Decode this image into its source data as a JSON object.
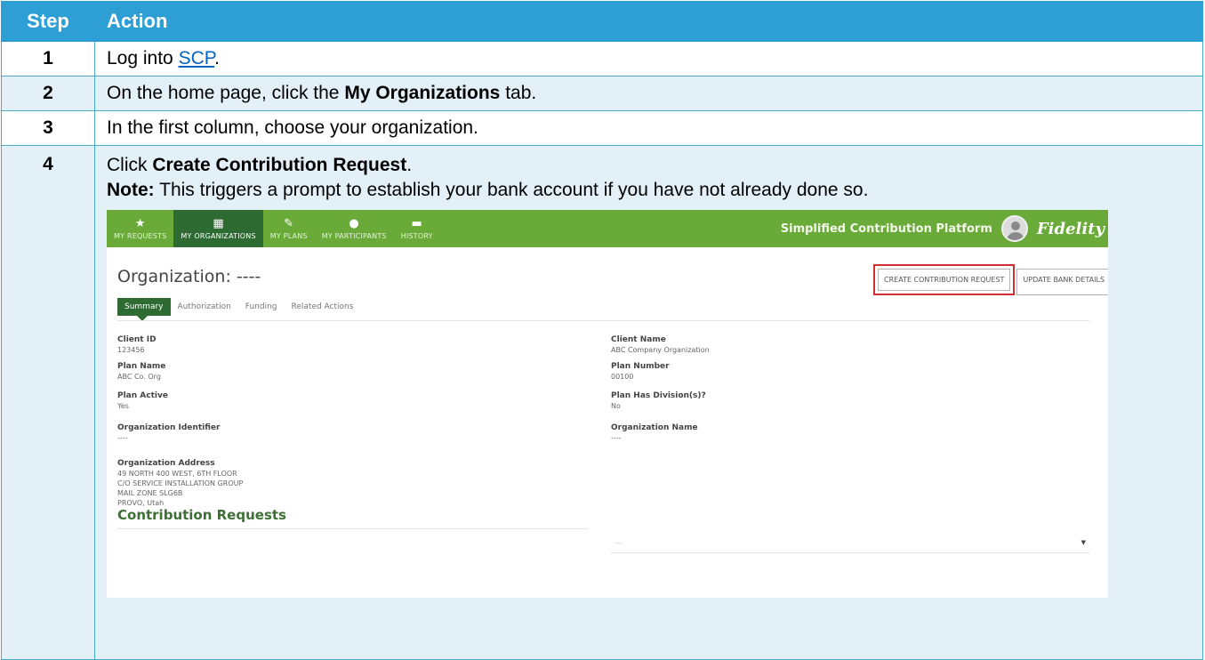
{
  "table": {
    "header": {
      "step": "Step",
      "action": "Action"
    },
    "rows": [
      {
        "num": "1",
        "before": "Log into ",
        "link": "SCP",
        "after": "."
      },
      {
        "num": "2",
        "before": "On the home page, click the ",
        "bold": "My Organizations",
        "after": " tab."
      },
      {
        "num": "3",
        "text": "In the first column, choose your organization."
      },
      {
        "num": "4",
        "before": "Click ",
        "bold": "Create Contribution Request",
        "after": ".",
        "note_label": "Note:",
        "note_text": " This triggers a prompt to establish your bank account if you have not already done so."
      }
    ]
  },
  "screenshot": {
    "nav": {
      "items": [
        {
          "label": "MY REQUESTS",
          "icon": "star-icon"
        },
        {
          "label": "MY ORGANIZATIONS",
          "icon": "building-icon",
          "active": true
        },
        {
          "label": "MY PLANS",
          "icon": "pencil-icon"
        },
        {
          "label": "MY PARTICIPANTS",
          "icon": "person-icon"
        },
        {
          "label": "HISTORY",
          "icon": "chart-icon"
        }
      ],
      "platform_title": "Simplified Contribution Platform",
      "logo": "Fidelity"
    },
    "org_title": "Organization: ----",
    "buttons": {
      "create": "CREATE CONTRIBUTION REQUEST",
      "update": "UPDATE BANK DETAILS"
    },
    "tabs": [
      "Summary",
      "Authorization",
      "Funding",
      "Related Actions"
    ],
    "fields": {
      "client_id": {
        "label": "Client ID",
        "value": "123456"
      },
      "client_name": {
        "label": "Client Name",
        "value": "ABC Company Organization"
      },
      "plan_name": {
        "label": "Plan Name",
        "value": "ABC Co. Org"
      },
      "plan_number": {
        "label": "Plan Number",
        "value": "00100"
      },
      "plan_active": {
        "label": "Plan Active",
        "value": "Yes"
      },
      "plan_divisions": {
        "label": "Plan Has Division(s)?",
        "value": "No"
      },
      "org_identifier": {
        "label": "Organization Identifier",
        "value": "----"
      },
      "org_name": {
        "label": "Organization Name",
        "value": "----"
      },
      "org_address": {
        "label": "Organization Address",
        "lines": [
          "49 NORTH 400 WEST, 6TH FLOOR",
          "C/O SERVICE INSTALLATION GROUP",
          "MAIL ZONE SLG6B",
          "PROVO, Utah"
        ]
      }
    },
    "contribution_requests": {
      "heading": "Contribution Requests",
      "filter_placeholder": "---"
    }
  }
}
